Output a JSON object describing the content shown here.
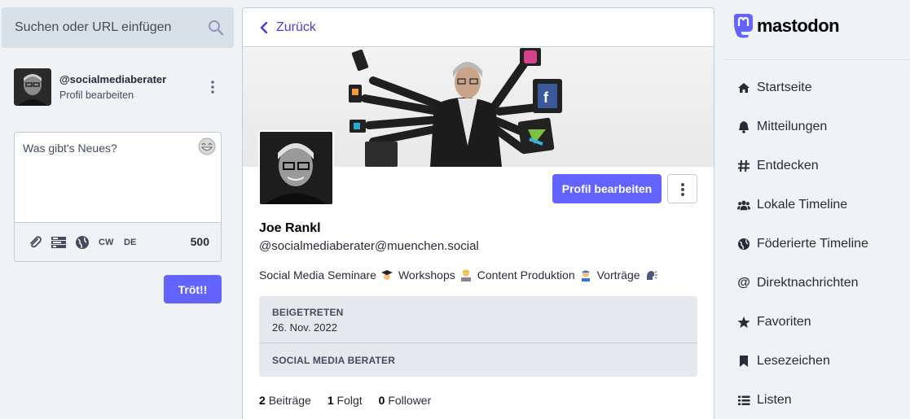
{
  "search": {
    "placeholder": "Suchen oder URL einfügen"
  },
  "me": {
    "acct": "@socialmediaberater",
    "edit_profile": "Profil bearbeiten"
  },
  "compose": {
    "placeholder": "Was gibt's Neues?",
    "visibility_cw": "CW",
    "language": "DE",
    "char_count": "500",
    "submit": "Tröt!!"
  },
  "profile": {
    "back_label": "Zurück",
    "edit_button": "Profil bearbeiten",
    "display_name": "Joe Rankl",
    "handle": "@socialmediaberater@muenchen.social",
    "bio": [
      {
        "text": "Social Media Seminare",
        "emoji": "graduation-cap"
      },
      {
        "text": "Workshops",
        "emoji": "person-laptop"
      },
      {
        "text": "Content Produktion",
        "emoji": "person-worker"
      },
      {
        "text": "Vorträge",
        "emoji": "speaking-head"
      }
    ],
    "fields": [
      {
        "key": "BEIGETRETEN",
        "value": "26. Nov. 2022"
      },
      {
        "key": "SOCIAL MEDIA BERATER",
        "value": ""
      }
    ],
    "stats": {
      "posts_count": "2",
      "posts_label": "Beiträge",
      "following_count": "1",
      "following_label": "Folgt",
      "followers_count": "0",
      "followers_label": "Follower"
    }
  },
  "brand": {
    "name": "mastodon",
    "accent": "#6364ff"
  },
  "nav": [
    {
      "label": "Startseite",
      "icon": "home-icon"
    },
    {
      "label": "Mitteilungen",
      "icon": "bell-icon"
    },
    {
      "label": "Entdecken",
      "icon": "hashtag-icon"
    },
    {
      "label": "Lokale Timeline",
      "icon": "users-icon"
    },
    {
      "label": "Föderierte Timeline",
      "icon": "globe-icon"
    },
    {
      "label": "Direktnachrichten",
      "icon": "at-icon"
    },
    {
      "label": "Favoriten",
      "icon": "star-icon"
    },
    {
      "label": "Lesezeichen",
      "icon": "bookmark-icon"
    },
    {
      "label": "Listen",
      "icon": "list-icon"
    }
  ]
}
